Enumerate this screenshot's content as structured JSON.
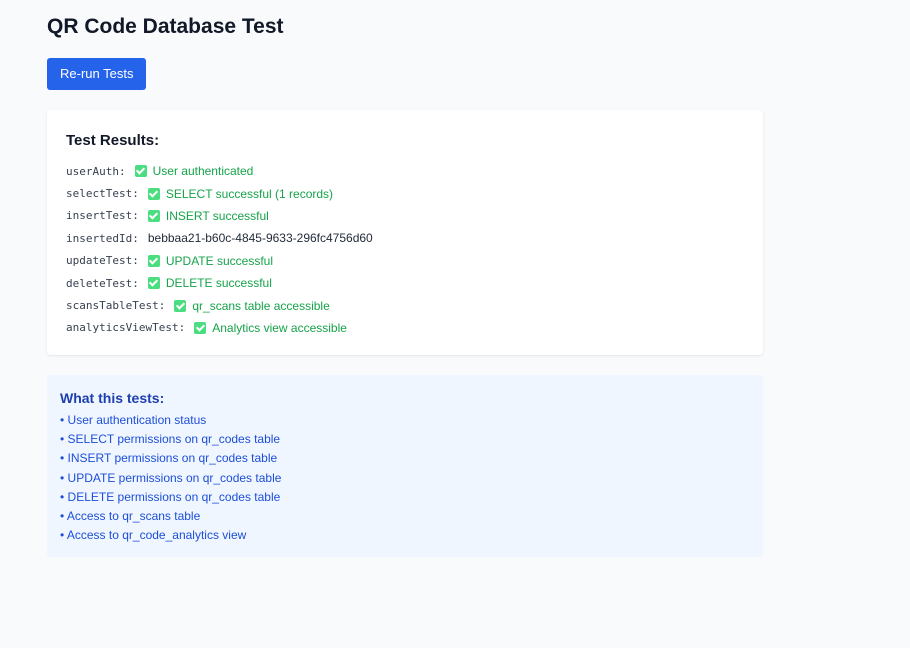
{
  "page": {
    "title": "QR Code Database Test",
    "rerun_button": "Re-run Tests"
  },
  "results": {
    "heading": "Test Results:",
    "rows": [
      {
        "key": "userAuth:",
        "value": "User authenticated",
        "status": "ok"
      },
      {
        "key": "selectTest:",
        "value": "SELECT successful (1 records)",
        "status": "ok"
      },
      {
        "key": "insertTest:",
        "value": "INSERT successful",
        "status": "ok"
      },
      {
        "key": "insertedId:",
        "value": "bebbaa21-b60c-4845-9633-296fc4756d60",
        "status": "plain"
      },
      {
        "key": "updateTest:",
        "value": "UPDATE successful",
        "status": "ok"
      },
      {
        "key": "deleteTest:",
        "value": "DELETE successful",
        "status": "ok"
      },
      {
        "key": "scansTableTest:",
        "value": "qr_scans table accessible",
        "status": "ok"
      },
      {
        "key": "analyticsViewTest:",
        "value": "Analytics view accessible",
        "status": "ok"
      }
    ]
  },
  "info": {
    "heading": "What this tests:",
    "items": [
      "• User authentication status",
      "• SELECT permissions on qr_codes table",
      "• INSERT permissions on qr_codes table",
      "• UPDATE permissions on qr_codes table",
      "• DELETE permissions on qr_codes table",
      "• Access to qr_scans table",
      "• Access to qr_code_analytics view"
    ]
  },
  "colors": {
    "primary_button": "#2563eb",
    "success_text": "#16a34a",
    "check_icon": "#4ade80",
    "info_background": "#eff6ff",
    "info_text": "#1d4ed8"
  }
}
